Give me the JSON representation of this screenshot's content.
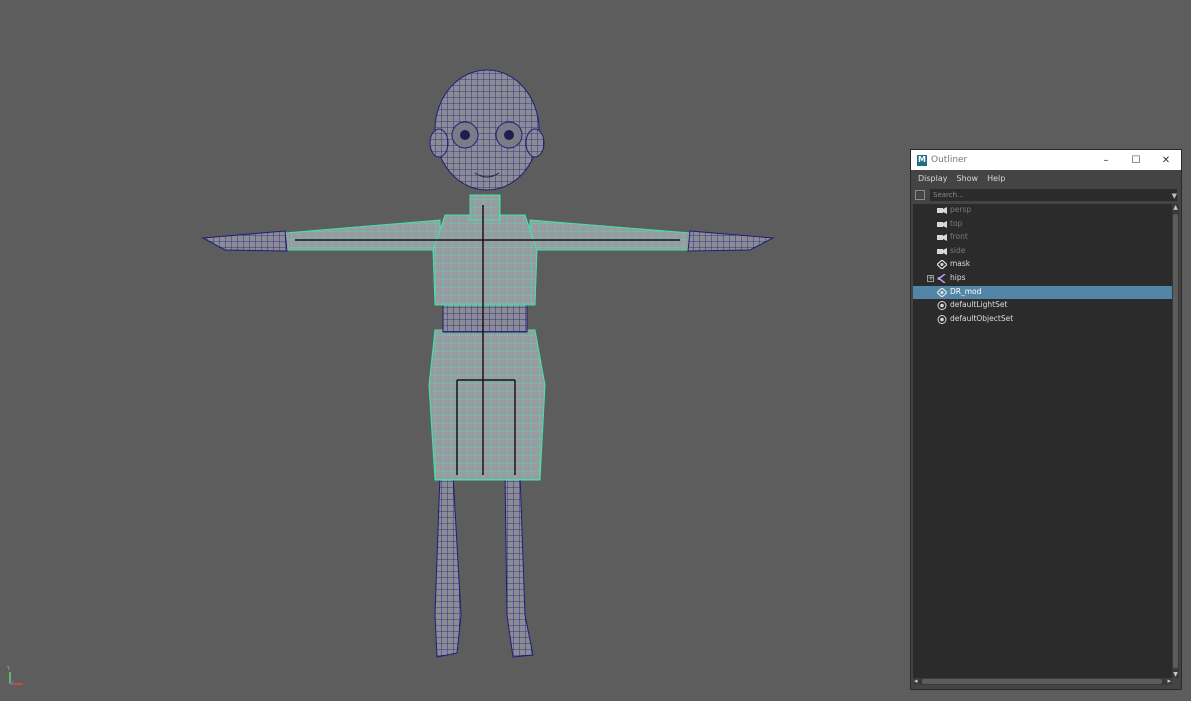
{
  "outliner": {
    "title": "Outliner",
    "app_icon_letter": "M",
    "window_buttons": {
      "minimize": "–",
      "maximize": "☐",
      "close": "✕"
    },
    "menu": [
      "Display",
      "Show",
      "Help"
    ],
    "search_placeholder": "Search...",
    "items": [
      {
        "label": "persp",
        "icon": "camera-icon",
        "dim": true
      },
      {
        "label": "top",
        "icon": "camera-icon",
        "dim": true
      },
      {
        "label": "front",
        "icon": "camera-icon",
        "dim": true
      },
      {
        "label": "side",
        "icon": "camera-icon",
        "dim": true
      },
      {
        "label": "mask",
        "icon": "transform-icon",
        "dim": false
      },
      {
        "label": "hips",
        "icon": "joint-icon",
        "dim": false,
        "expandable": true
      },
      {
        "label": "DR_mod",
        "icon": "transform-icon",
        "dim": false,
        "selected": true
      },
      {
        "label": "defaultLightSet",
        "icon": "set-icon",
        "dim": false
      },
      {
        "label": "defaultObjectSet",
        "icon": "set-icon",
        "dim": false
      }
    ]
  },
  "colors": {
    "viewport_bg": "#5d5d5d",
    "selection": "#5285a6",
    "wireframe": "#1a1a70",
    "selected_wire": "#3ee8a8"
  }
}
